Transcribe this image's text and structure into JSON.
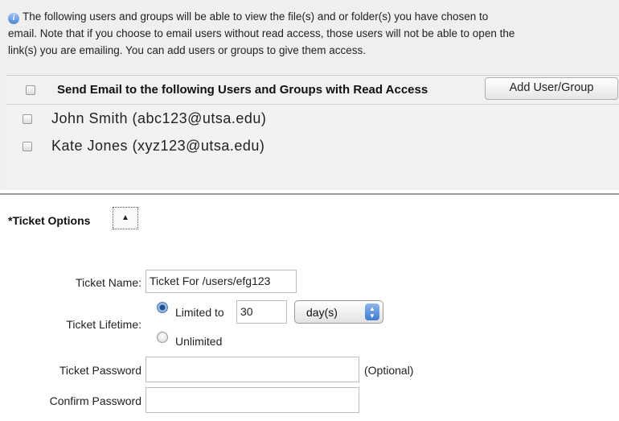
{
  "info": {
    "line1": "The following users and groups will be able to view the file(s) and or folder(s) you have chosen to",
    "line2": "email. Note that if you choose to email users without read access, those users will not be able to open the",
    "line3": "link(s) you are emailing. You can add users or groups to give them access."
  },
  "recipients": {
    "header_label": "Send Email to the following Users and Groups with Read Access",
    "add_button_label": "Add User/Group",
    "users": [
      {
        "label": "John Smith (abc123@utsa.edu)"
      },
      {
        "label": "Kate Jones (xyz123@utsa.edu)"
      }
    ]
  },
  "ticket_options": {
    "title": "*Ticket Options",
    "toggle_glyph": "▲",
    "name_label": "Ticket Name:",
    "name_value": "Ticket For /users/efg123",
    "lifetime_label": "Ticket Lifetime:",
    "limited_label": "Limited to",
    "limited_value": "30",
    "unit_selected": "day(s)",
    "unlimited_label": "Unlimited",
    "lifetime_selected": "limited",
    "password_label": "Ticket Password",
    "password_hint": "(Optional)",
    "confirm_label": "Confirm Password"
  },
  "icons": {
    "info": "info-icon",
    "collapse": "chevron-up-icon"
  }
}
